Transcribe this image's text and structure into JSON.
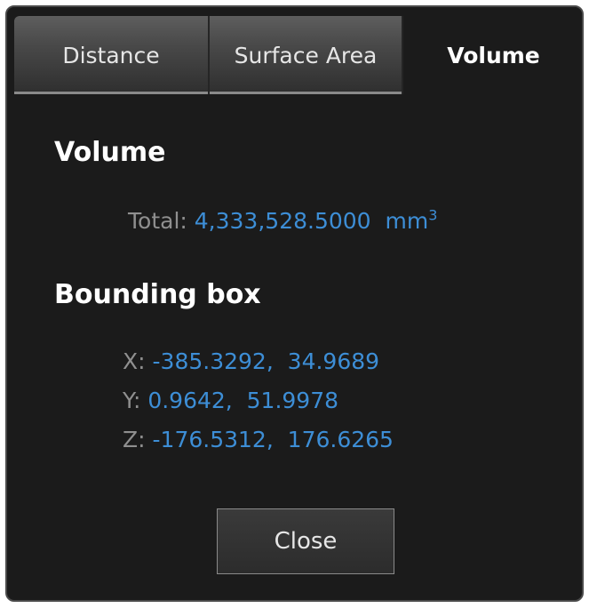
{
  "tabs": [
    {
      "label": "Distance",
      "active": false
    },
    {
      "label": "Surface Area",
      "active": false
    },
    {
      "label": "Volume",
      "active": true
    }
  ],
  "volume": {
    "title": "Volume",
    "total_label": "Total:",
    "total_value": "4,333,528.5000",
    "unit": "mm",
    "unit_exponent": "3"
  },
  "bounding_box": {
    "title": "Bounding box",
    "x_label": "X:",
    "x_value": "-385.3292,  34.9689",
    "y_label": "Y:",
    "y_value": "0.9642,  51.9978",
    "z_label": "Z:",
    "z_value": "-176.5312,  176.6265"
  },
  "close_label": "Close",
  "colors": {
    "background": "#1b1b1b",
    "value_accent": "#3d8ed6",
    "label_gray": "#8f8f8f"
  }
}
